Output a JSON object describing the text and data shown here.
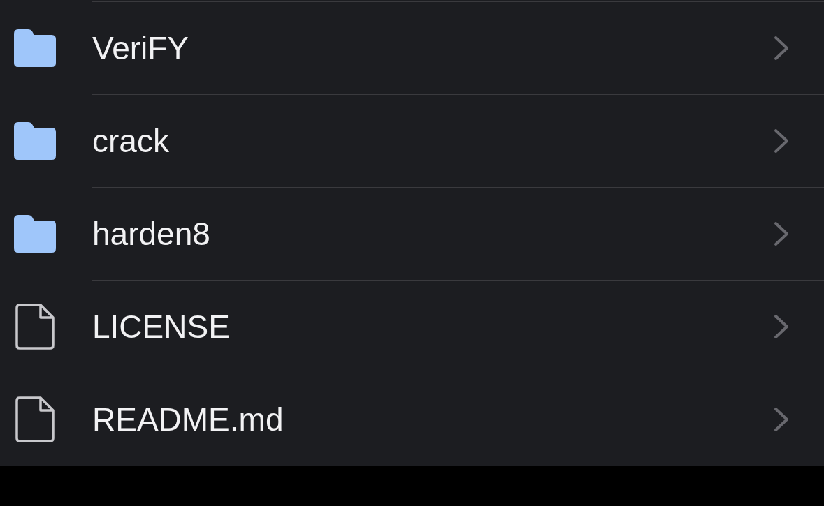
{
  "items": [
    {
      "name": "VeriFY",
      "kind": "folder"
    },
    {
      "name": "crack",
      "kind": "folder"
    },
    {
      "name": "harden8",
      "kind": "folder"
    },
    {
      "name": "LICENSE",
      "kind": "file"
    },
    {
      "name": "README.md",
      "kind": "file"
    }
  ]
}
